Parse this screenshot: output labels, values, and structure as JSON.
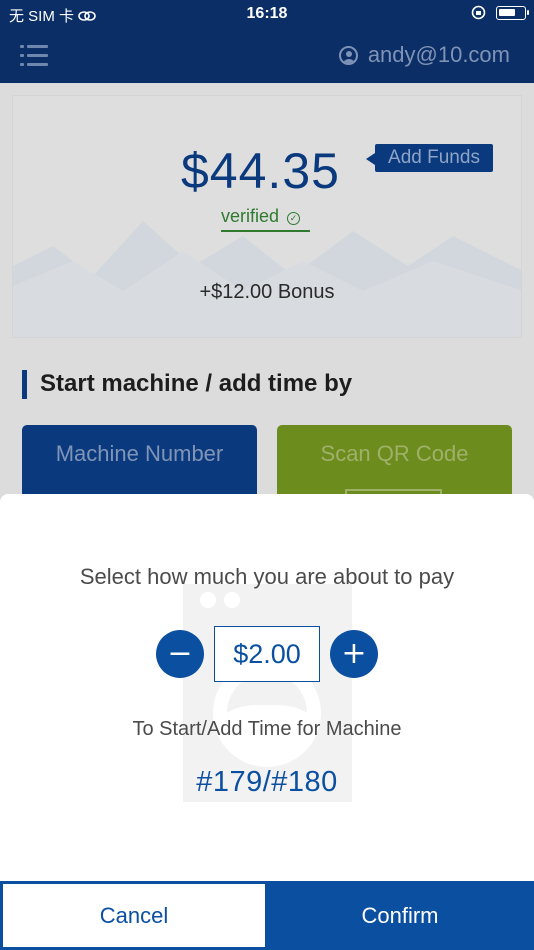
{
  "status_bar": {
    "carrier": "无 SIM 卡",
    "time": "16:18",
    "battery_level": 0.7
  },
  "header": {
    "user_email": "andy@10.com",
    "icons": [
      "menu-icon",
      "user-icon"
    ]
  },
  "balance_card": {
    "balance": "$44.35",
    "add_funds_label": "Add Funds",
    "verified_label": "verified",
    "bonus": "+$12.00 Bonus"
  },
  "start_section": {
    "title": "Start machine / add time by",
    "machine_number_label": "Machine Number",
    "scan_qr_label": "Scan QR Code"
  },
  "payment_sheet": {
    "prompt": "Select how much you are about to pay",
    "amount": "$2.00",
    "minus_symbol": "−",
    "plus_symbol": "+",
    "machine_label": "To Start/Add Time for Machine",
    "machine_ids": "#179/#180",
    "cancel_label": "Cancel",
    "confirm_label": "Confirm"
  },
  "colors": {
    "header_bg": "#0b2e66",
    "primary": "#0b4fa1",
    "success": "#2f7a2f",
    "qr_button": "#6c8d1d"
  }
}
